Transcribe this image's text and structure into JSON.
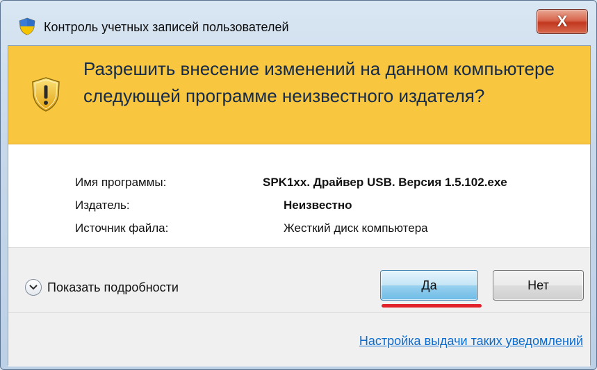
{
  "window": {
    "title": "Контроль учетных записей пользователей",
    "close_label": "X"
  },
  "banner": {
    "question": "Разрешить внесение изменений на данном компьютере следующей программе неизвестного издателя?"
  },
  "details": {
    "program_label": "Имя программы:",
    "program_value": "SPK1xx. Драйвер USB. Версия 1.5.102.exe",
    "publisher_label": "Издатель:",
    "publisher_value": "Неизвестно",
    "source_label": "Источник файла:",
    "source_value": "Жесткий диск компьютера"
  },
  "footer": {
    "show_details_label": "Показать подробности",
    "yes_label": "Да",
    "no_label": "Нет",
    "settings_link": "Настройка выдачи таких уведомлений"
  },
  "colors": {
    "banner": "#f8c63f",
    "link": "#0a6ccf",
    "highlight": "#e1222b"
  },
  "icons": {
    "title": "uac-shield-icon",
    "banner": "warning-shield-icon",
    "toggle": "chevron-down-icon"
  }
}
